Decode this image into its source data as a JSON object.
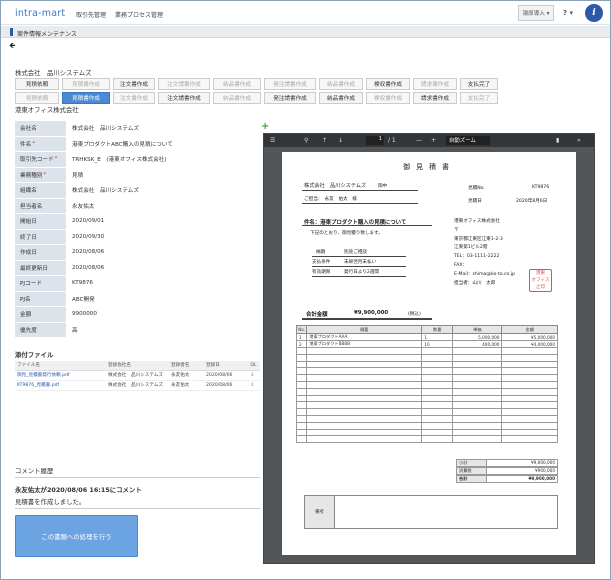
{
  "header": {
    "logo": "intra-mart",
    "nav": [
      "取引先管理",
      "業務プロセス管理"
    ],
    "user_label": "湯原導入 ▾",
    "help_label": "? ▾",
    "info_label": "i"
  },
  "page_title": "案件情報メンテナンス",
  "back_icon": "back-arrow-icon",
  "company1": "株式会社　品川システムズ",
  "buttons_row1": [
    {
      "label": "見積依頼",
      "state": "normal"
    },
    {
      "label": "見積書作成",
      "state": "disabled"
    },
    {
      "label": "注文書作成",
      "state": "normal"
    },
    {
      "label": "注文請書作成",
      "state": "disabled"
    },
    {
      "label": "納品書作成",
      "state": "disabled"
    },
    {
      "label": "発注請書作成",
      "state": "disabled"
    },
    {
      "label": "納品書作成",
      "state": "disabled"
    },
    {
      "label": "検収書作成",
      "state": "normal"
    },
    {
      "label": "請求書作成",
      "state": "disabled"
    },
    {
      "label": "支払完了",
      "state": "normal"
    }
  ],
  "buttons_row2": [
    {
      "label": "見積依頼",
      "state": "disabled"
    },
    {
      "label": "見積書作成",
      "state": "active"
    },
    {
      "label": "注文書作成",
      "state": "disabled"
    },
    {
      "label": "注文請書作成",
      "state": "normal"
    },
    {
      "label": "納品書作成",
      "state": "disabled"
    },
    {
      "label": "発注請書作成",
      "state": "normal"
    },
    {
      "label": "納品書作成",
      "state": "normal"
    },
    {
      "label": "検収書作成",
      "state": "disabled"
    },
    {
      "label": "請求書作成",
      "state": "normal"
    },
    {
      "label": "支払完了",
      "state": "disabled"
    }
  ],
  "company2": "港東オフィス株式会社",
  "form": [
    {
      "label": "会社名",
      "value": "株式会社　品川システムズ",
      "required": false
    },
    {
      "label": "件名",
      "value": "港東プロダクトABC購入の見積について",
      "required": true
    },
    {
      "label": "取引先コード",
      "value": "TRHKSK_E　(港東オフィス株式会社)",
      "required": true
    },
    {
      "label": "業務種別",
      "value": "見積",
      "required": true
    },
    {
      "label": "組織名",
      "value": "株式会社　品川システムズ",
      "required": false
    },
    {
      "label": "担当者名",
      "value": "永友佑太",
      "required": false
    },
    {
      "label": "開始日",
      "value": "2020/09/01",
      "required": false
    },
    {
      "label": "終了日",
      "value": "2020/09/30",
      "required": false
    },
    {
      "label": "作成日",
      "value": "2020/08/06",
      "required": false
    },
    {
      "label": "最終更新日",
      "value": "2020/08/06",
      "required": false
    },
    {
      "label": "PJコード",
      "value": "KT9876",
      "required": false
    },
    {
      "label": "PJ名",
      "value": "ABC開発",
      "required": false
    },
    {
      "label": "金額",
      "value": "9900000",
      "required": false
    },
    {
      "label": "優先度",
      "value": "高",
      "required": false
    }
  ],
  "attachments": {
    "title": "添付ファイル",
    "headers": [
      "ファイル名",
      "登録会社名",
      "登録者名",
      "登録日",
      "DL"
    ],
    "rows": [
      [
        "御見_見積書発行依頼.pdf",
        "株式会社　品川システムズ",
        "永友佑太",
        "2020/08/06",
        "⇩"
      ],
      [
        "KT9876_見積書.pdf",
        "株式会社　品川システムズ",
        "永友佑太",
        "2020/08/06",
        "⇩"
      ]
    ]
  },
  "comments": {
    "title": "コメント履歴",
    "user": "永友佑太が2020/08/06 16:15にコメント",
    "text": "見積書を作成しました。"
  },
  "process_button": "この書類への処理を行う",
  "pdf_viewer": {
    "page": "1",
    "total": "/ 1",
    "zoom": "自動ズーム"
  },
  "pdf": {
    "title": "御見積書",
    "to_company": "株式会社　品川システムズ",
    "honorific": "御中",
    "attn": "ご担当：　永友　佑太　様",
    "no_label": "見積No.",
    "no_value": "KT9876",
    "date_label": "見積日",
    "date_value": "2020年8月6日",
    "subject": "件名：港東プロダクト購入の見積について",
    "intro": "下記のとおり、御見積り致します。",
    "issuer_lines": [
      "港東オフィス株式会社",
      "〒",
      "東京都江東区江東1-2-3",
      "江東第1ビル2階",
      "TEL：03-1111-2222",
      "FAX：",
      "E-Mail：shima@ko-to.co.jp",
      "担当者：山川　太郎"
    ],
    "terms": [
      [
        "納期",
        "別途ご相談"
      ],
      [
        "支払条件",
        "末締翌月末払い"
      ],
      [
        "有効期限",
        "発行日より2週間"
      ]
    ],
    "total_label": "合計金額",
    "total_value": "¥9,900,000",
    "tax_note": "(税込)",
    "item_headers": [
      "No.",
      "摘要",
      "数量",
      "単価",
      "金額"
    ],
    "items": [
      [
        "1",
        "港東プロダクトAAA",
        "1",
        "5,000,000",
        "¥5,000,000"
      ],
      [
        "2",
        "港東プロダクトBBBB",
        "10",
        "400,000",
        "¥4,000,000"
      ]
    ],
    "subtotal_label": "小計",
    "subtotal_value": "¥9,000,000",
    "tax_label": "消費税",
    "tax_value": "¥900,000",
    "grand_label": "合計",
    "grand_value": "¥9,900,000",
    "notes_label": "備考",
    "stamp_text": "港東オフィス株式会社"
  }
}
